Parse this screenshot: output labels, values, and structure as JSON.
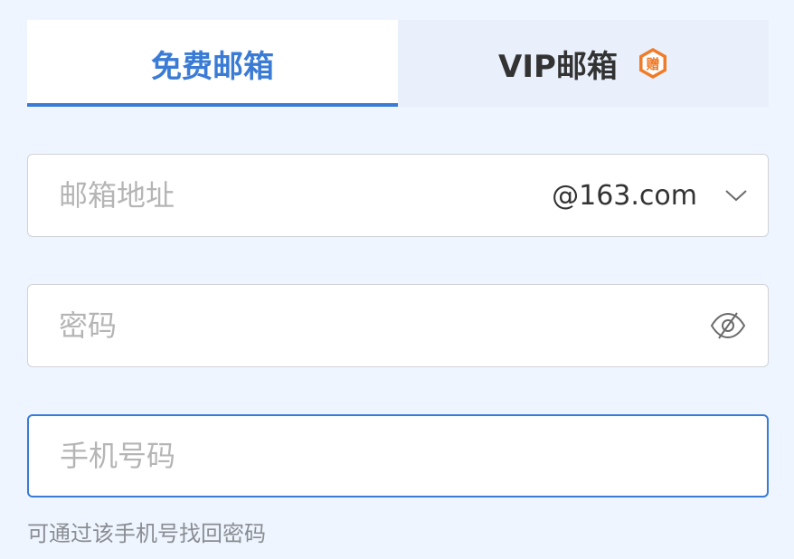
{
  "tabs": {
    "free_label": "免费邮箱",
    "vip_label": "VIP邮箱",
    "vip_badge_text": "赠",
    "vip_badge_color": "#f07b28",
    "active_color": "#3a7bd5"
  },
  "email": {
    "placeholder": "邮箱地址",
    "value": "",
    "domain": "@163.com"
  },
  "password": {
    "placeholder": "密码",
    "value": "",
    "visibility_icon": "eye-slash-icon"
  },
  "phone": {
    "placeholder": "手机号码",
    "value": "",
    "hint": "可通过该手机号找回密码"
  }
}
